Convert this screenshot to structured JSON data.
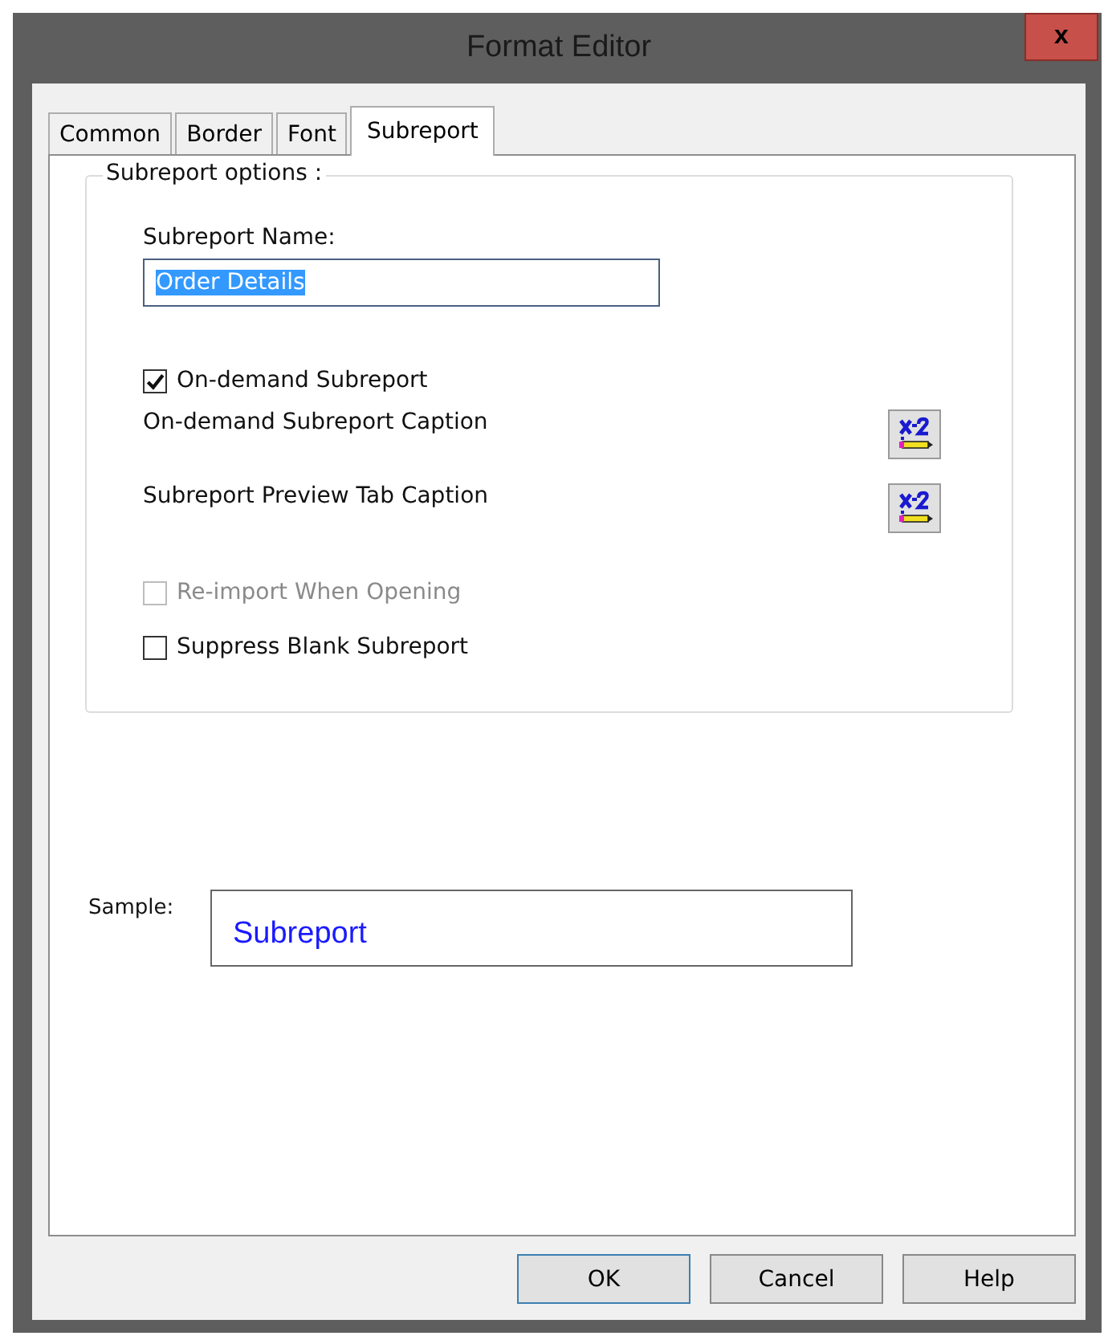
{
  "window": {
    "title": "Format Editor",
    "close": "x"
  },
  "tabs": [
    {
      "label": "Common",
      "selected": false
    },
    {
      "label": "Border",
      "selected": false
    },
    {
      "label": "Font",
      "selected": false
    },
    {
      "label": "Subreport",
      "selected": true
    }
  ],
  "group": {
    "title": "Subreport options :"
  },
  "name_field": {
    "label": "Subreport Name:",
    "value": "Order Details",
    "selected": true
  },
  "options": [
    {
      "kind": "checkbox",
      "label": "On-demand Subreport",
      "checked": true,
      "disabled": false
    },
    {
      "kind": "caption",
      "label": "On-demand Subreport Caption"
    },
    {
      "kind": "caption",
      "label": "Subreport Preview Tab Caption"
    },
    {
      "kind": "checkbox",
      "label": "Re-import When Opening",
      "checked": false,
      "disabled": true
    },
    {
      "kind": "checkbox",
      "label": "Suppress Blank Subreport",
      "checked": false,
      "disabled": false
    }
  ],
  "sample": {
    "label": "Sample:",
    "text": "Subreport"
  },
  "buttons": [
    {
      "label": "OK",
      "default": true
    },
    {
      "label": "Cancel",
      "default": false
    },
    {
      "label": "Help",
      "default": false
    }
  ]
}
